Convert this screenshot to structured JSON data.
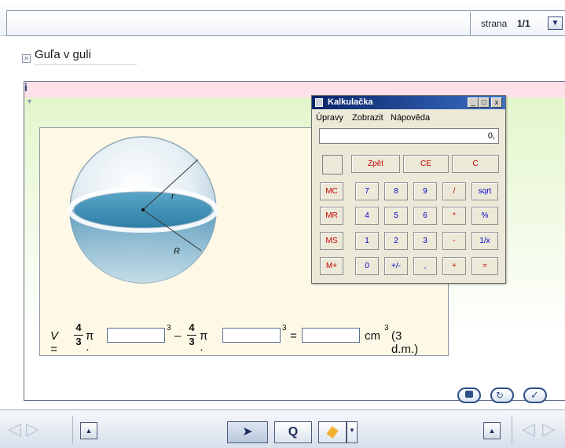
{
  "header": {
    "page_label": "strana",
    "page_number": "1/1",
    "dropdown_glyph": "▼"
  },
  "title": {
    "text": "Guľa v guli",
    "close_glyph": "×"
  },
  "info": {
    "label": "i"
  },
  "figure": {
    "radius_small": "r",
    "radius_large": "R"
  },
  "formula": {
    "v_label": "V =",
    "num": "4",
    "den": "3",
    "pi_dot": "π ·",
    "exp": "3",
    "minus": "–",
    "equals": "=",
    "unit": "cm",
    "note": "(3 d.m.)",
    "inputs": [
      "",
      "",
      ""
    ]
  },
  "calculator": {
    "title": "Kalkulačka",
    "menu": [
      "Úpravy",
      "Zobrazit",
      "Nápověda"
    ],
    "display": "0,",
    "top_buttons": [
      "Zpět",
      "CE",
      "C"
    ],
    "memory_buttons": [
      "MC",
      "MR",
      "MS",
      "M+"
    ],
    "rows": [
      [
        "7",
        "8",
        "9",
        "/",
        "sqrt"
      ],
      [
        "4",
        "5",
        "6",
        "*",
        "%"
      ],
      [
        "1",
        "2",
        "3",
        "-",
        "1/x"
      ],
      [
        "0",
        "+/-",
        ",",
        "+",
        "="
      ]
    ],
    "window_buttons": [
      "_",
      "□",
      "x"
    ]
  },
  "colors": {
    "accent": "#2d4f87",
    "calc_red": "#cc0000",
    "calc_blue": "#0000cc",
    "panel_green": "#e2f5c8",
    "strip_pink": "#fde0e8"
  },
  "icons": [
    "check-icon",
    "reload-icon",
    "hint-icon",
    "pointer-icon",
    "zoom-icon",
    "pencil-icon"
  ]
}
